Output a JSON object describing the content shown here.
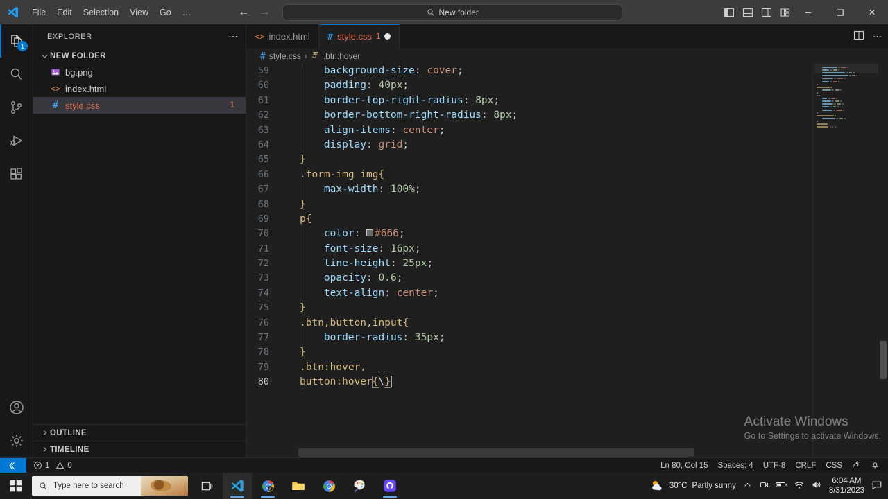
{
  "titlebar": {
    "logo_icon": "vscode-logo-icon",
    "menus": [
      "File",
      "Edit",
      "Selection",
      "View",
      "Go",
      "…"
    ],
    "nav_back_icon": "arrow-left-icon",
    "nav_forward_icon": "arrow-right-icon",
    "command_center": {
      "search_icon": "search-icon",
      "text": "New folder"
    },
    "layout_icons": [
      "toggle-primary-sidebar-icon",
      "toggle-panel-icon",
      "toggle-secondary-sidebar-icon",
      "customize-layout-icon"
    ],
    "window_controls": {
      "minimize": "─",
      "maximize": "❑",
      "close": "✕"
    }
  },
  "activitybar": {
    "items": [
      {
        "name": "explorer",
        "icon": "files-icon",
        "active": true,
        "badge": "1"
      },
      {
        "name": "search",
        "icon": "search-icon",
        "active": false,
        "badge": ""
      },
      {
        "name": "source-control",
        "icon": "source-control-icon",
        "active": false,
        "badge": ""
      },
      {
        "name": "run-and-debug",
        "icon": "run-and-debug-icon",
        "active": false,
        "badge": ""
      },
      {
        "name": "extensions",
        "icon": "extensions-icon",
        "active": false,
        "badge": ""
      }
    ],
    "bottom": [
      {
        "name": "accounts",
        "icon": "account-icon"
      },
      {
        "name": "settings",
        "icon": "gear-icon"
      }
    ]
  },
  "sidebar": {
    "title": "EXPLORER",
    "more_actions_icon": "more-actions-icon",
    "folder": {
      "name": "NEW FOLDER",
      "expanded": true,
      "chevron_icon": "chevron-down-icon"
    },
    "files": [
      {
        "name": "bg.png",
        "icon": "image-file-icon",
        "selected": false,
        "badge": ""
      },
      {
        "name": "index.html",
        "icon": "html-file-icon",
        "selected": false,
        "badge": ""
      },
      {
        "name": "style.css",
        "icon": "css-file-icon",
        "selected": true,
        "badge": "1"
      }
    ],
    "panels": [
      {
        "label": "OUTLINE",
        "chevron_icon": "chevron-right-icon"
      },
      {
        "label": "TIMELINE",
        "chevron_icon": "chevron-right-icon"
      }
    ]
  },
  "editor": {
    "tabs": [
      {
        "label": "index.html",
        "icon": "html-file-icon",
        "active": false,
        "error_count": "",
        "dirty": false
      },
      {
        "label": "style.css",
        "icon": "css-file-icon",
        "active": true,
        "error_count": "1",
        "dirty": true
      }
    ],
    "tab_actions": [
      "split-editor-right-icon",
      "more-actions-icon"
    ],
    "breadcrumb": {
      "file_icon": "css-file-icon",
      "file": "style.css",
      "separator": "›",
      "symbol_icon": "css-symbol-icon",
      "symbol": ".btn:hover"
    },
    "first_line_number": 59,
    "cursor_line": 80,
    "color_swatch_hex": "#666666",
    "lines": [
      {
        "n": 59,
        "indent": 1,
        "tokens": [
          {
            "t": "prop",
            "v": "background-size"
          },
          {
            "t": "pun",
            "v": ": "
          },
          {
            "t": "val",
            "v": "cover"
          },
          {
            "t": "pun",
            "v": ";"
          }
        ]
      },
      {
        "n": 60,
        "indent": 1,
        "tokens": [
          {
            "t": "prop",
            "v": "padding"
          },
          {
            "t": "pun",
            "v": ": "
          },
          {
            "t": "num",
            "v": "40px"
          },
          {
            "t": "pun",
            "v": ";"
          }
        ]
      },
      {
        "n": 61,
        "indent": 1,
        "tokens": [
          {
            "t": "prop",
            "v": "border-top-right-radius"
          },
          {
            "t": "pun",
            "v": ": "
          },
          {
            "t": "num",
            "v": "8px"
          },
          {
            "t": "pun",
            "v": ";"
          }
        ]
      },
      {
        "n": 62,
        "indent": 1,
        "tokens": [
          {
            "t": "prop",
            "v": "border-bottom-right-radius"
          },
          {
            "t": "pun",
            "v": ": "
          },
          {
            "t": "num",
            "v": "8px"
          },
          {
            "t": "pun",
            "v": ";"
          }
        ]
      },
      {
        "n": 63,
        "indent": 1,
        "tokens": [
          {
            "t": "prop",
            "v": "align-items"
          },
          {
            "t": "pun",
            "v": ": "
          },
          {
            "t": "val",
            "v": "center"
          },
          {
            "t": "pun",
            "v": ";"
          }
        ]
      },
      {
        "n": 64,
        "indent": 1,
        "tokens": [
          {
            "t": "prop",
            "v": "display"
          },
          {
            "t": "pun",
            "v": ": "
          },
          {
            "t": "val",
            "v": "grid"
          },
          {
            "t": "pun",
            "v": ";"
          }
        ]
      },
      {
        "n": 65,
        "indent": 0,
        "tokens": [
          {
            "t": "brace",
            "v": "}"
          }
        ]
      },
      {
        "n": 66,
        "indent": 0,
        "tokens": [
          {
            "t": "sel",
            "v": ".form-img img"
          },
          {
            "t": "brace",
            "v": "{"
          }
        ]
      },
      {
        "n": 67,
        "indent": 1,
        "tokens": [
          {
            "t": "prop",
            "v": "max-width"
          },
          {
            "t": "pun",
            "v": ": "
          },
          {
            "t": "num",
            "v": "100%"
          },
          {
            "t": "pun",
            "v": ";"
          }
        ]
      },
      {
        "n": 68,
        "indent": 0,
        "tokens": [
          {
            "t": "brace",
            "v": "}"
          }
        ]
      },
      {
        "n": 69,
        "indent": 0,
        "tokens": [
          {
            "t": "sel",
            "v": "p"
          },
          {
            "t": "brace",
            "v": "{"
          }
        ]
      },
      {
        "n": 70,
        "indent": 1,
        "tokens": [
          {
            "t": "prop",
            "v": "color"
          },
          {
            "t": "pun",
            "v": ": "
          },
          {
            "t": "swatch",
            "v": ""
          },
          {
            "t": "val",
            "v": "#666"
          },
          {
            "t": "pun",
            "v": ";"
          }
        ]
      },
      {
        "n": 71,
        "indent": 1,
        "tokens": [
          {
            "t": "prop",
            "v": "font-size"
          },
          {
            "t": "pun",
            "v": ": "
          },
          {
            "t": "num",
            "v": "16px"
          },
          {
            "t": "pun",
            "v": ";"
          }
        ]
      },
      {
        "n": 72,
        "indent": 1,
        "tokens": [
          {
            "t": "prop",
            "v": "line-height"
          },
          {
            "t": "pun",
            "v": ": "
          },
          {
            "t": "num",
            "v": "25px"
          },
          {
            "t": "pun",
            "v": ";"
          }
        ]
      },
      {
        "n": 73,
        "indent": 1,
        "tokens": [
          {
            "t": "prop",
            "v": "opacity"
          },
          {
            "t": "pun",
            "v": ": "
          },
          {
            "t": "num",
            "v": "0.6"
          },
          {
            "t": "pun",
            "v": ";"
          }
        ]
      },
      {
        "n": 74,
        "indent": 1,
        "tokens": [
          {
            "t": "prop",
            "v": "text-align"
          },
          {
            "t": "pun",
            "v": ": "
          },
          {
            "t": "val",
            "v": "center"
          },
          {
            "t": "pun",
            "v": ";"
          }
        ]
      },
      {
        "n": 75,
        "indent": 0,
        "tokens": [
          {
            "t": "brace",
            "v": "}"
          }
        ]
      },
      {
        "n": 76,
        "indent": 0,
        "tokens": [
          {
            "t": "sel",
            "v": ".btn,button,input"
          },
          {
            "t": "brace",
            "v": "{"
          }
        ]
      },
      {
        "n": 77,
        "indent": 1,
        "tokens": [
          {
            "t": "prop",
            "v": "border-radius"
          },
          {
            "t": "pun",
            "v": ": "
          },
          {
            "t": "num",
            "v": "35px"
          },
          {
            "t": "pun",
            "v": ";"
          }
        ]
      },
      {
        "n": 78,
        "indent": 0,
        "tokens": [
          {
            "t": "brace",
            "v": "}"
          }
        ]
      },
      {
        "n": 79,
        "indent": 0,
        "tokens": [
          {
            "t": "sel",
            "v": ".btn:hover,"
          }
        ]
      },
      {
        "n": 80,
        "indent": 0,
        "tokens": [
          {
            "t": "sel",
            "v": "button:hover"
          },
          {
            "t": "bracebox",
            "v": "{"
          },
          {
            "t": "pun",
            "v": "\\"
          },
          {
            "t": "bracebox",
            "v": "}"
          },
          {
            "t": "cursor",
            "v": ""
          }
        ]
      }
    ]
  },
  "watermark": {
    "title": "Activate Windows",
    "subtitle": "Go to Settings to activate Windows."
  },
  "statusbar": {
    "remote_icon": "remote-window-icon",
    "errors_icon": "error-icon",
    "errors": "1",
    "warnings_icon": "warning-icon",
    "warnings": "0",
    "position": "Ln 80, Col 15",
    "indent": "Spaces: 4",
    "encoding": "UTF-8",
    "eol": "CRLF",
    "language": "CSS",
    "feedback_icon": "feedback-smiley-icon",
    "notifications_icon": "bell-icon"
  },
  "taskbar": {
    "start_icon": "windows-start-icon",
    "search": {
      "icon": "search-icon",
      "placeholder": "Type here to search"
    },
    "task_view_icon": "task-view-icon",
    "apps": [
      {
        "name": "vscode",
        "icon": "vscode-icon",
        "running": true,
        "active": true
      },
      {
        "name": "chrome-beta",
        "icon": "chrome-beta-icon",
        "running": true,
        "active": false
      },
      {
        "name": "file-explorer",
        "icon": "file-explorer-icon",
        "running": false,
        "active": false
      },
      {
        "name": "chrome",
        "icon": "chrome-icon",
        "running": false,
        "active": false
      },
      {
        "name": "paint",
        "icon": "paint-icon",
        "running": false,
        "active": false
      },
      {
        "name": "app-purple",
        "icon": "purple-app-icon",
        "running": true,
        "active": false
      }
    ],
    "tray": {
      "weather_icon": "partly-sunny-icon",
      "temperature": "30°C",
      "condition": "Partly sunny",
      "chevron_icon": "chevron-up-icon",
      "icons": [
        "camera-icon",
        "battery-icon",
        "wifi-icon",
        "volume-icon"
      ],
      "time": "6:04 AM",
      "date": "8/31/2023",
      "action_center_icon": "notification-icon"
    }
  }
}
